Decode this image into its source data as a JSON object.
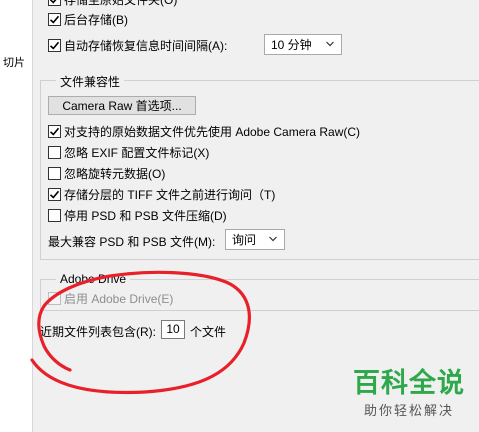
{
  "side_label": "切片",
  "top_options": [
    {
      "label": "存储至原始文件夹(O)",
      "checked": true
    },
    {
      "label": "后台存储(B)",
      "checked": true
    },
    {
      "label": "自动存储恢复信息时间间隔(A):",
      "checked": true
    }
  ],
  "autosave_interval": "10 分钟",
  "file_compat": {
    "title": "文件兼容性",
    "camera_raw_button": "Camera Raw 首选项...",
    "options": [
      {
        "label": "对支持的原始数据文件优先使用 Adobe Camera Raw(C)",
        "checked": true
      },
      {
        "label": "忽略 EXIF 配置文件标记(X)",
        "checked": false
      },
      {
        "label": "忽略旋转元数据(O)",
        "checked": false
      },
      {
        "label": "存储分层的 TIFF 文件之前进行询问（T)",
        "checked": true
      },
      {
        "label": "停用 PSD 和 PSB 文件压缩(D)",
        "checked": false
      }
    ],
    "max_compat_label": "最大兼容 PSD 和 PSB 文件(M):",
    "max_compat_value": "询问"
  },
  "adobe_drive": {
    "title": "Adobe Drive",
    "option_label": "启用 Adobe Drive(E)",
    "checked": false,
    "disabled": true
  },
  "recent_files": {
    "label": "近期文件列表包含(R):",
    "value": "10",
    "unit": "个文件"
  },
  "watermark": {
    "title": "百科全说",
    "subtitle": "助你轻松解决"
  },
  "colors": {
    "annotation": "#e8202a",
    "watermark_green": "#2ea84a"
  }
}
